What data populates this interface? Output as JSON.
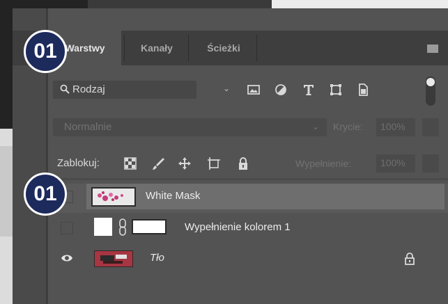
{
  "tabs": [
    {
      "label": "Warstwy",
      "active": true
    },
    {
      "label": "Kanały",
      "active": false
    },
    {
      "label": "Ścieżki",
      "active": false
    }
  ],
  "filter": {
    "kind_label": "Rodzaj"
  },
  "blend": {
    "mode": "Normalnie",
    "opacity_label": "Krycie:",
    "opacity_value": "100%"
  },
  "lock": {
    "label": "Zablokuj:",
    "fill_label": "Wypełnienie:",
    "fill_value": "100%"
  },
  "layers": [
    {
      "name": "White Mask",
      "selected": true,
      "visible": false
    },
    {
      "name": "Wypełnienie kolorem 1",
      "selected": false,
      "visible": false
    },
    {
      "name": "Tło",
      "selected": false,
      "visible": true,
      "locked": true
    }
  ],
  "badges": [
    {
      "text": "01"
    },
    {
      "text": "01"
    }
  ],
  "colors": {
    "panel": "#535353",
    "tabbar": "#3e3e3e",
    "badge": "#1d2a5c",
    "selected_row": "#6e6e6e"
  }
}
